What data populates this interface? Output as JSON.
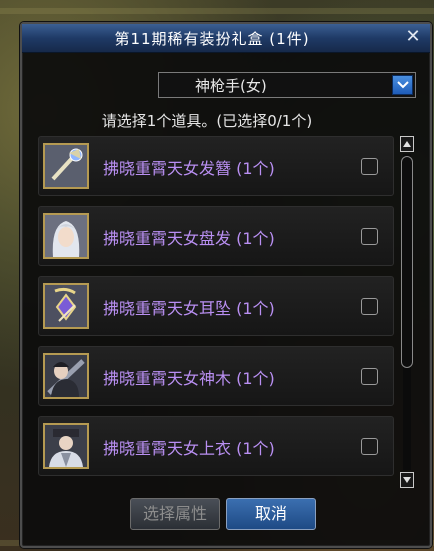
{
  "dialog": {
    "title": "第11期稀有装扮礼盒 (1件)",
    "close_label": "✕",
    "job_select": {
      "value": "神枪手(女)"
    },
    "instruction": "请选择1个道具。(已选择0/1个)",
    "items": [
      {
        "name": "拂晓重霄天女发簪 (1个)",
        "icon": "hairpin-icon",
        "checked": false
      },
      {
        "name": "拂晓重霄天女盘发 (1个)",
        "icon": "hair-portrait-icon",
        "checked": false
      },
      {
        "name": "拂晓重霄天女耳坠 (1个)",
        "icon": "earring-icon",
        "checked": false
      },
      {
        "name": "拂晓重霄天女神木 (1个)",
        "icon": "weapon-portrait-icon",
        "checked": false
      },
      {
        "name": "拂晓重霄天女上衣 (1个)",
        "icon": "top-portrait-icon",
        "checked": false
      }
    ],
    "buttons": {
      "select_attr": "选择属性",
      "cancel": "取消"
    }
  },
  "colors": {
    "title_bar": "#2a4a7c",
    "item_name": "#b98ff2",
    "item_border": "#b59a52"
  }
}
